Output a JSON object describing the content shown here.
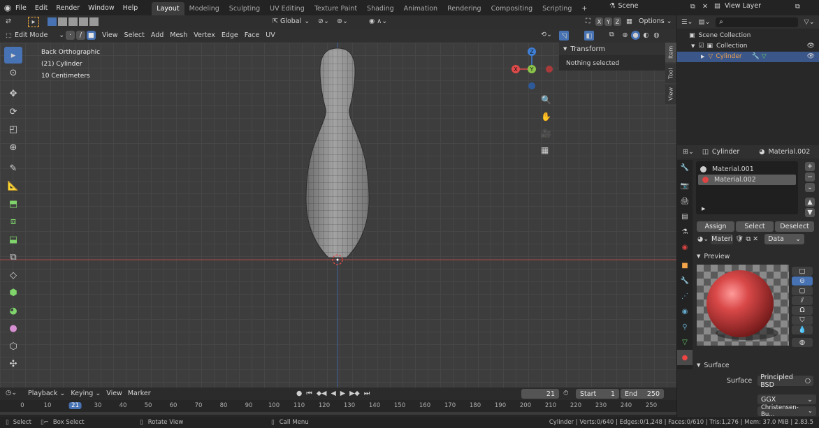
{
  "topbar": {
    "menus": [
      "File",
      "Edit",
      "Render",
      "Window",
      "Help"
    ],
    "workspaces": [
      "Layout",
      "Modeling",
      "Sculpting",
      "UV Editing",
      "Texture Paint",
      "Shading",
      "Animation",
      "Rendering",
      "Compositing",
      "Scripting"
    ],
    "active_workspace": "Layout",
    "scene": "Scene",
    "view_layer": "View Layer"
  },
  "viewport_header": {
    "transform_orientation": "Global",
    "options": "Options",
    "axes": [
      "X",
      "Y",
      "Z"
    ]
  },
  "viewport_header2": {
    "mode": "Edit Mode",
    "menus": [
      "View",
      "Select",
      "Add",
      "Mesh",
      "Vertex",
      "Edge",
      "Face",
      "UV"
    ]
  },
  "viewport": {
    "view_name": "Back Orthographic",
    "object_info": "(21) Cylinder",
    "scale": "10 Centimeters",
    "gizmo": {
      "x": "X",
      "y": "Y",
      "z": "Z"
    }
  },
  "n_panel": {
    "title": "Transform",
    "message": "Nothing selected",
    "tabs": [
      "Item",
      "Tool",
      "View"
    ]
  },
  "outliner": {
    "scene_collection": "Scene Collection",
    "collection": "Collection",
    "object": "Cylinder"
  },
  "properties": {
    "object": "Cylinder",
    "material": "Material.002",
    "slots": [
      "Material.001",
      "Material.002"
    ],
    "buttons": {
      "assign": "Assign",
      "select": "Select",
      "deselect": "Deselect"
    },
    "material_field": "Materi",
    "link": "Data",
    "preview_label": "Preview",
    "surface_label": "Surface",
    "surface_field_label": "Surface",
    "surface_shader": "Principled BSD",
    "distribution": "GGX",
    "subsurface": "Christensen-Bu..."
  },
  "timeline": {
    "menus": [
      "Playback",
      "Keying",
      "View",
      "Marker"
    ],
    "current_frame": "21",
    "start_label": "Start",
    "start": "1",
    "end_label": "End",
    "end": "250",
    "ticks": [
      "0",
      "10",
      "21",
      "30",
      "40",
      "50",
      "60",
      "70",
      "80",
      "90",
      "100",
      "110",
      "120",
      "130",
      "140",
      "150",
      "160",
      "170",
      "180",
      "190",
      "200",
      "210",
      "220",
      "230",
      "240",
      "250"
    ]
  },
  "statusbar": {
    "select": "Select",
    "box_select": "Box Select",
    "rotate": "Rotate View",
    "call_menu": "Call Menu",
    "stats": "Cylinder | Verts:0/640 | Edges:0/1,248 | Faces:0/610 | Tris:1,276 | Mem: 37.0 MiB | 2.83.5"
  },
  "colors": {
    "accent": "#4772b3",
    "material_red": "#c94040",
    "x_axis": "#e04a4a",
    "y_axis": "#8bc34a",
    "z_axis": "#3f7fd6"
  }
}
